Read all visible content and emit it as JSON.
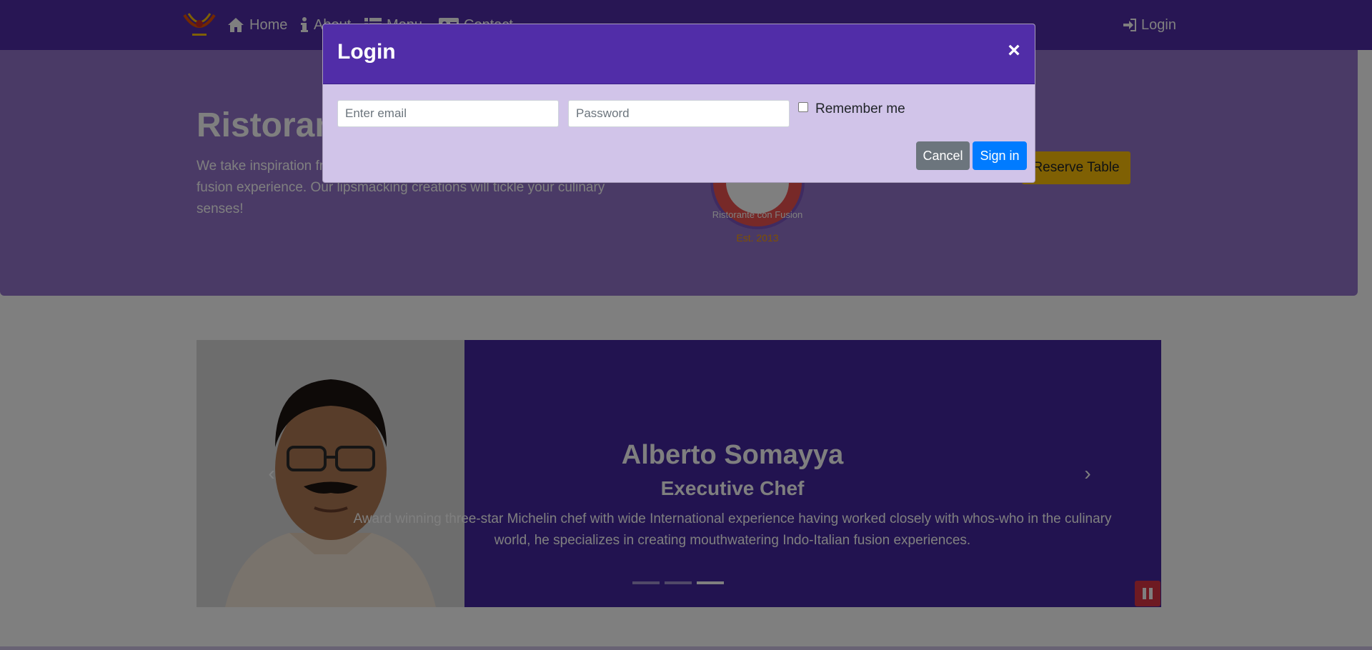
{
  "nav": {
    "brand_icon": "restaurant-logo",
    "home_label": "Home",
    "about_label": "About",
    "menu_label": "Menu",
    "contact_label": "Contact",
    "login_label": "Login",
    "bg_color": "#512da8"
  },
  "jumbotron": {
    "title": "Ristorante con Fusion",
    "text": "We take inspiration from the World's best cuisines, and create a unique fusion experience. Our lipsmacking creations will tickle your culinary senses!",
    "logo_text": "Ristorante con Fusion",
    "logo_est": "Est. 2013",
    "reserve_label": "Reserve Table",
    "bg_color": "#9575cd"
  },
  "carousel": {
    "name": "Alberto Somayya",
    "role": "Executive Chef",
    "description": "Award winning three-star Michelin chef with wide International experience having worked closely with whos-who in the culinary world, he specializes in creating mouthwatering Indo-Italian fusion experiences.",
    "indicator_count": 3,
    "active_indicator": 3,
    "bg_color": "#4527a0"
  },
  "modal": {
    "title": "Login",
    "close_symbol": "×",
    "email_placeholder": "Enter email",
    "password_placeholder": "Password",
    "remember_label": "Remember me",
    "cancel_label": "Cancel",
    "signin_label": "Sign in",
    "header_color": "#512da8",
    "body_color": "#d1c4e9"
  }
}
